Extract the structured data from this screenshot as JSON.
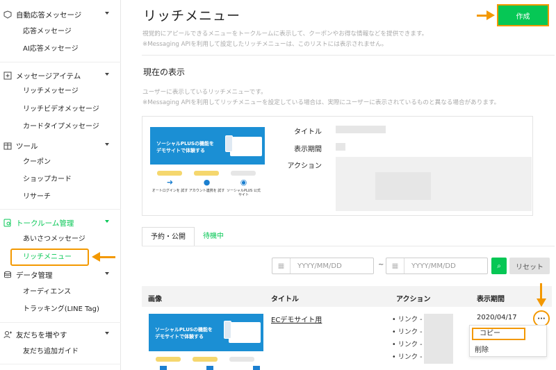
{
  "sidebar": {
    "sections": [
      {
        "key": "auto",
        "label": "自動応答メッセージ",
        "icon": "speech-bubble-icon",
        "items": [
          "応答メッセージ",
          "AI応答メッセージ"
        ]
      },
      {
        "key": "items",
        "label": "メッセージアイテム",
        "icon": "plus-square-icon",
        "items": [
          "リッチメッセージ",
          "リッチビデオメッセージ",
          "カードタイプメッセージ"
        ]
      },
      {
        "key": "tools",
        "label": "ツール",
        "icon": "toolbox-icon",
        "items": [
          "クーポン",
          "ショップカード",
          "リサーチ"
        ]
      },
      {
        "key": "talkroom",
        "label": "トークルーム管理",
        "icon": "talkroom-icon",
        "items": [
          "あいさつメッセージ",
          "リッチメニュー"
        ]
      },
      {
        "key": "data",
        "label": "データ管理",
        "icon": "database-icon",
        "items": [
          "オーディエンス",
          "トラッキング(LINE Tag)"
        ]
      },
      {
        "key": "friends",
        "label": "友だちを増やす",
        "icon": "add-friend-icon",
        "items": [
          "友だち追加ガイド"
        ]
      }
    ]
  },
  "header": {
    "title": "リッチメニュー",
    "desc1": "視覚的にアピールできるメニューをトークルームに表示して、クーポンやお得な情報などを提供できます。",
    "desc2": "※Messaging APIを利用して設定したリッチメニューは、このリストには表示されません。",
    "create_label": "作成"
  },
  "current": {
    "title": "現在の表示",
    "desc1": "ユーザーに表示しているリッチメニューです。",
    "desc2": "※Messaging APIを利用してリッチメニューを設定している場合は、実際にユーザーに表示されているものと異なる場合があります。",
    "labels": {
      "title": "タイトル",
      "period": "表示期間",
      "action": "アクション"
    },
    "banner": {
      "headline": "ソーシャルPLUSの機能を デモサイトで体験する",
      "tiles": [
        {
          "label": "オートログインを 試す",
          "icon": "login-arrow-icon"
        },
        {
          "label": "アカウント連携を 試す",
          "icon": "person-icon"
        },
        {
          "label": "ソーシャルPLUS 公式サイト",
          "icon": "info-circle-icon"
        }
      ]
    }
  },
  "tabs": [
    "予約・公開",
    "待機中"
  ],
  "filter": {
    "date_placeholder": "YYYY/MM/DD",
    "tilde": "~",
    "reset_label": "リセット",
    "calendar_icon": "calendar-icon",
    "search_icon": "search-icon"
  },
  "table": {
    "headers": [
      "画像",
      "タイトル",
      "アクション",
      "表示期間"
    ],
    "rows": [
      {
        "title": "ECデモサイト用",
        "links": [
          "• リンク -",
          "• リンク -",
          "• リンク -",
          "• リンク -"
        ],
        "date": "2020/04/17",
        "more": "···"
      }
    ]
  },
  "menu": {
    "copy": "コピー",
    "delete": "削除"
  },
  "colors": {
    "accent": "#06c755",
    "highlight": "#f39800",
    "banner": "#1b8fd4"
  }
}
